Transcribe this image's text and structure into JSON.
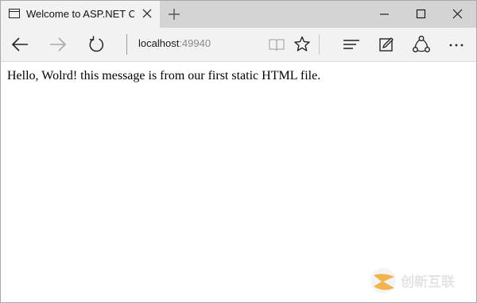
{
  "window": {
    "tab_title": "Welcome to ASP.NET Co"
  },
  "navbar": {
    "address_host": "localhost",
    "address_port": ":49940"
  },
  "page": {
    "body_text": "Hello, Wolrd! this message is from our first static HTML file."
  },
  "watermark": {
    "text": "创新互联"
  },
  "icons": {
    "tab": "page-icon",
    "close_tab": "close-icon",
    "new_tab": "plus-icon",
    "back": "arrow-left-icon",
    "forward": "arrow-right-icon",
    "refresh": "refresh-icon",
    "reading_view": "book-icon",
    "favorite": "star-icon",
    "hub": "hub-icon",
    "notes": "pen-icon",
    "share": "share-icon",
    "more": "more-icon"
  },
  "colors": {
    "tab_strip": "#d4d4d4",
    "active_tab": "#f2f2f2",
    "toolbar": "#f2f2f2",
    "watermark_orange": "#f0a11a"
  }
}
